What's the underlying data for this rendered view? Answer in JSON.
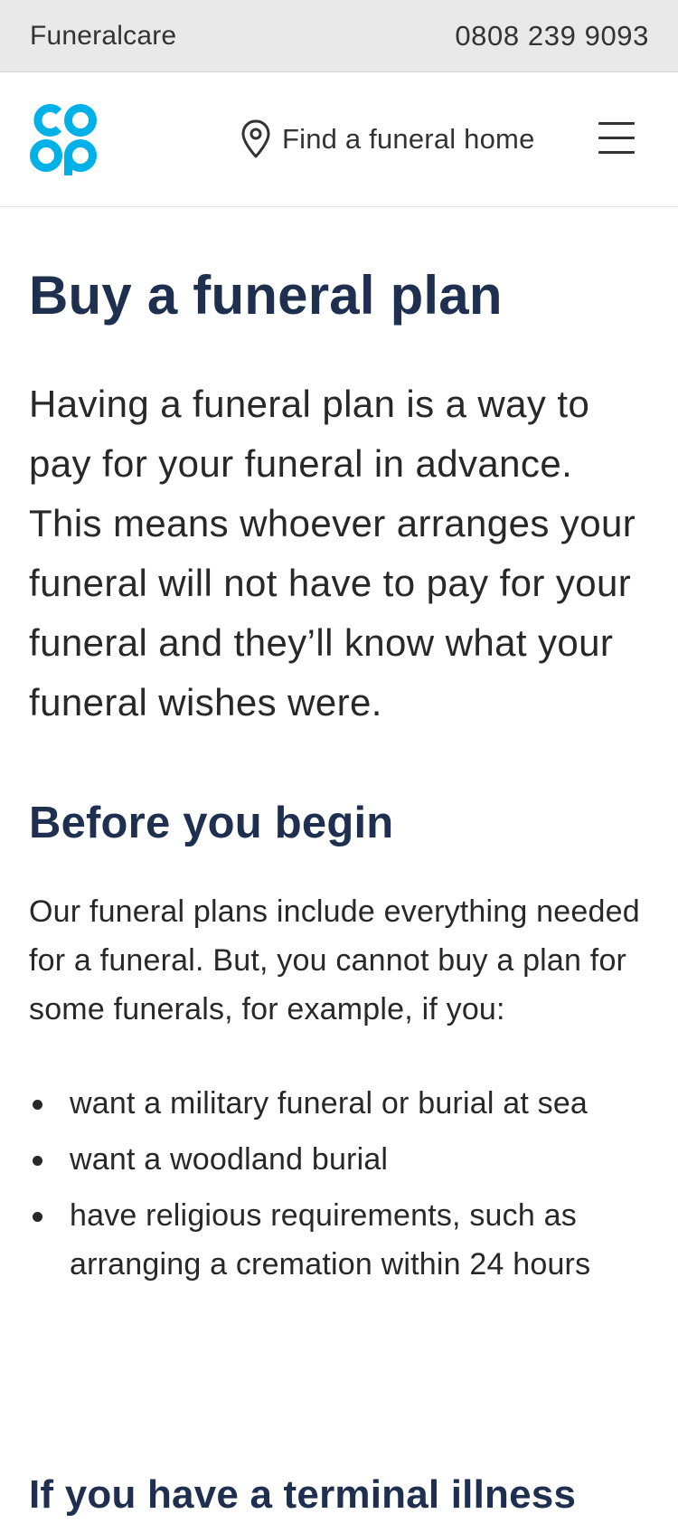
{
  "topbar": {
    "brand": "Funeralcare",
    "phone": "0808 239 9093"
  },
  "header": {
    "logo_name": "co-op-logo",
    "find_label": "Find a funeral home",
    "find_icon": "location-pin-icon",
    "menu_icon": "hamburger-menu-icon"
  },
  "colors": {
    "brand_blue": "#00b1e7",
    "heading_navy": "#1e2f4f",
    "topbar_bg": "#e9e9e9",
    "text": "#282828"
  },
  "main": {
    "title": "Buy a funeral plan",
    "intro": "Having a funeral plan is a way to pay for your funeral in advance. This means whoever arranges your funeral will not have to pay for your funeral and they’ll know what your funeral wishes were.",
    "section1": {
      "heading": "Before you begin",
      "body": "Our funeral plans include everything needed for a funeral. But, you cannot buy a plan for some funerals, for example, if you:",
      "bullets": [
        "want a military funeral or burial at sea",
        "want a woodland burial",
        "have religious requirements, such as arranging a cremation within 24 hours"
      ]
    },
    "section2": {
      "heading": "If you have a terminal illness"
    }
  }
}
